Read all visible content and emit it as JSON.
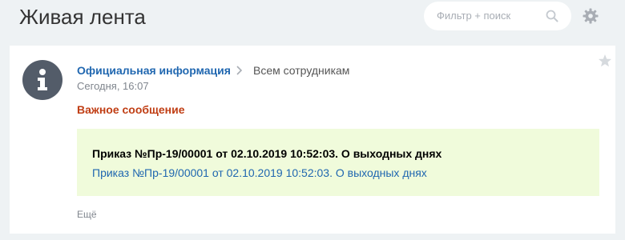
{
  "header": {
    "title": "Живая лента",
    "search": {
      "placeholder": "Фильтр + поиск",
      "icon": "search-icon"
    },
    "settings_icon": "gear-icon"
  },
  "post": {
    "avatar_icon": "info-icon",
    "author": "Официальная информация",
    "audience": "Всем сотрудникам",
    "date": "Сегодня, 16:07",
    "title": "Важное сообщение",
    "message": {
      "heading": "Приказ №Пр-19/00001 от 02.10.2019 10:52:03. О выходных днях",
      "link": "Приказ №Пр-19/00001 от 02.10.2019 10:52:03. О выходных днях"
    },
    "more_label": "Ещё"
  },
  "colors": {
    "background": "#eef2f4",
    "link": "#2067b0",
    "important": "#c03e14",
    "message_bg": "#f0fbdb",
    "avatar_bg": "#535c69"
  }
}
